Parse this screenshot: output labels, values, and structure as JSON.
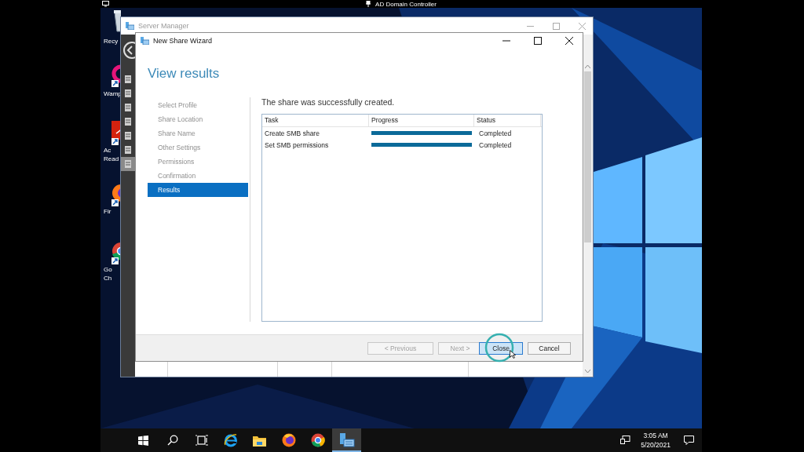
{
  "remote_bar": {
    "title": "AD Domain Controller"
  },
  "desktop_icons": [
    {
      "kind": "recycle",
      "lines": [
        "Recy"
      ]
    },
    {
      "kind": "wamp",
      "lines": [
        "Wamp"
      ]
    },
    {
      "kind": "acrobat",
      "lines": [
        "Ac",
        "Read"
      ]
    },
    {
      "kind": "firefox",
      "lines": [
        "Fir"
      ]
    },
    {
      "kind": "chrome",
      "lines": [
        "Go",
        "Ch"
      ]
    }
  ],
  "server_manager": {
    "title": "Server Manager"
  },
  "wizard": {
    "title": "New Share Wizard",
    "heading": "View results",
    "steps": [
      {
        "label": "Select Profile",
        "selected": false
      },
      {
        "label": "Share Location",
        "selected": false
      },
      {
        "label": "Share Name",
        "selected": false
      },
      {
        "label": "Other Settings",
        "selected": false
      },
      {
        "label": "Permissions",
        "selected": false
      },
      {
        "label": "Confirmation",
        "selected": false
      },
      {
        "label": "Results",
        "selected": true
      }
    ],
    "message": "The share was successfully created.",
    "table": {
      "columns": [
        "Task",
        "Progress",
        "Status"
      ],
      "rows": [
        {
          "task": "Create SMB share",
          "level": 1,
          "status": "Completed"
        },
        {
          "task": "Set SMB permissions",
          "level": 1,
          "status": "Completed"
        }
      ]
    },
    "buttons": [
      {
        "label": "< Previous",
        "disabled": true,
        "highlighted": false
      },
      {
        "label": "Next >",
        "disabled": true,
        "highlighted": false
      },
      {
        "label": "Close",
        "disabled": false,
        "highlighted": true
      },
      {
        "label": "Cancel",
        "disabled": false,
        "highlighted": false
      }
    ]
  },
  "taskbar": {
    "apps": [
      {
        "kind": "start",
        "active": false
      },
      {
        "kind": "search",
        "active": false
      },
      {
        "kind": "taskview",
        "active": false
      },
      {
        "kind": "ie",
        "active": false
      },
      {
        "kind": "explorer",
        "active": false
      },
      {
        "kind": "firefox",
        "active": false
      },
      {
        "kind": "chrome",
        "active": false
      },
      {
        "kind": "servermanager",
        "active": true
      }
    ],
    "time": "3:05 AM",
    "date": "5/20/2021"
  }
}
